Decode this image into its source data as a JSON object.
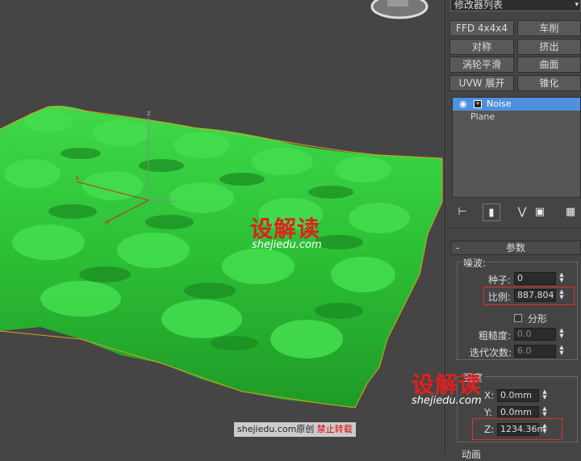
{
  "modifier_list": {
    "label": "修改器列表",
    "arrow": "▾"
  },
  "buttons": [
    {
      "label": "FFD 4x4x4"
    },
    {
      "label": "车削"
    },
    {
      "label": "对称"
    },
    {
      "label": "挤出"
    },
    {
      "label": "涡轮平滑"
    },
    {
      "label": "曲面"
    },
    {
      "label": "UVW 展开"
    },
    {
      "label": "锥化"
    }
  ],
  "stack": {
    "items": [
      {
        "label": "Noise",
        "selected": true
      },
      {
        "label": "Plane",
        "selected": false
      }
    ]
  },
  "params": {
    "rollout_title": "参数",
    "rollout_toggle": "-",
    "noise_group": "噪波:",
    "seed_label": "种子:",
    "seed_value": "0",
    "scale_label": "比例:",
    "scale_value": "887.804",
    "fractal_label": "分形",
    "roughness_label": "粗糙度:",
    "roughness_value": "0.0",
    "iterations_label": "迭代次数:",
    "iterations_value": "6.0",
    "strength_group": "强度",
    "x_label": "X:",
    "x_value": "0.0mm",
    "y_label": "Y:",
    "y_value": "0.0mm",
    "z_label": "Z:",
    "z_value": "1234.36m",
    "animation_group": "动画"
  },
  "watermark": {
    "brand": "设解读",
    "url": "shejiedu.com",
    "footer_site": "shejiedu.com原创",
    "footer_warning": "禁止转载"
  },
  "gizmo": {
    "x_label": "x",
    "y_label": "y",
    "z_label": "z"
  },
  "colors": {
    "terrain": "#2ec23a",
    "selection": "#5090e0",
    "highlight_box": "#e03030",
    "watermark": "#e02020"
  }
}
